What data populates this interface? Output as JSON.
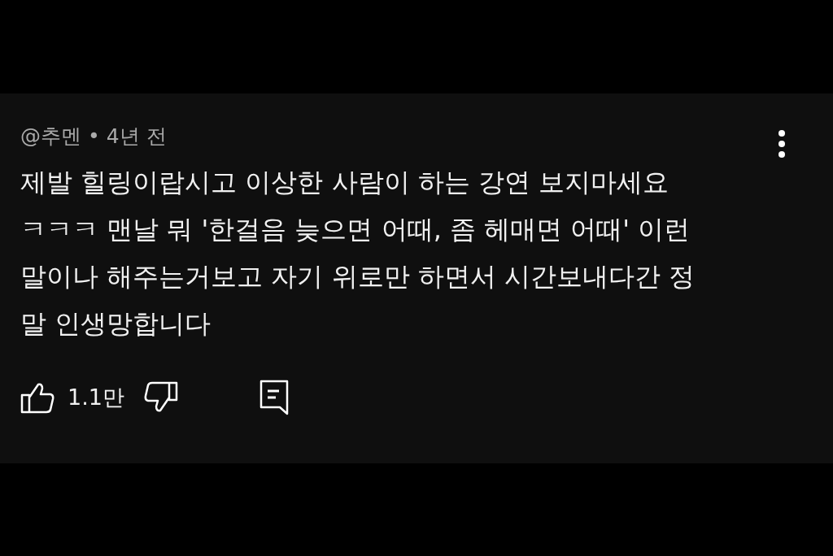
{
  "comment": {
    "author": "@추멘",
    "separator": "•",
    "time": "4년 전",
    "text_lines": [
      "제발 힐링이랍시고 이상한 사람이 하는 강연 보지마세요",
      "ㅋㅋㅋ 맨날 뭐 '한걸음 늦으면 어때, 좀 헤매면 어때' 이런",
      "말이나 해주는거보고 자기 위로만 하면서 시간보내다간 정",
      "말 인생망합니다"
    ],
    "likes": "1.1만",
    "liked": false,
    "disliked": false
  }
}
